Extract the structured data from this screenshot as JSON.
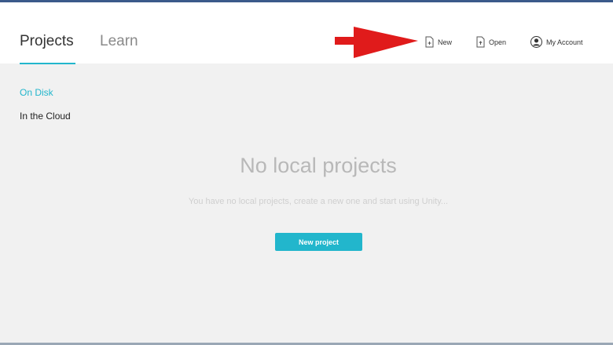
{
  "header": {
    "tabs": [
      {
        "label": "Projects",
        "active": true
      },
      {
        "label": "Learn",
        "active": false
      }
    ],
    "actions": {
      "new_label": "New",
      "open_label": "Open",
      "account_label": "My Account"
    }
  },
  "sidebar": {
    "items": [
      {
        "label": "On Disk",
        "active": true
      },
      {
        "label": "In the Cloud",
        "active": false
      }
    ]
  },
  "main": {
    "empty_title": "No local projects",
    "empty_description": "You have no local projects, create a new one and start using Unity...",
    "new_project_button": "New project"
  },
  "annotation": {
    "icon": "red-arrow-icon",
    "color": "#e01b1b"
  },
  "colors": {
    "accent": "#22b6cc",
    "header_bg": "#ffffff",
    "content_bg": "#f1f1f1"
  }
}
